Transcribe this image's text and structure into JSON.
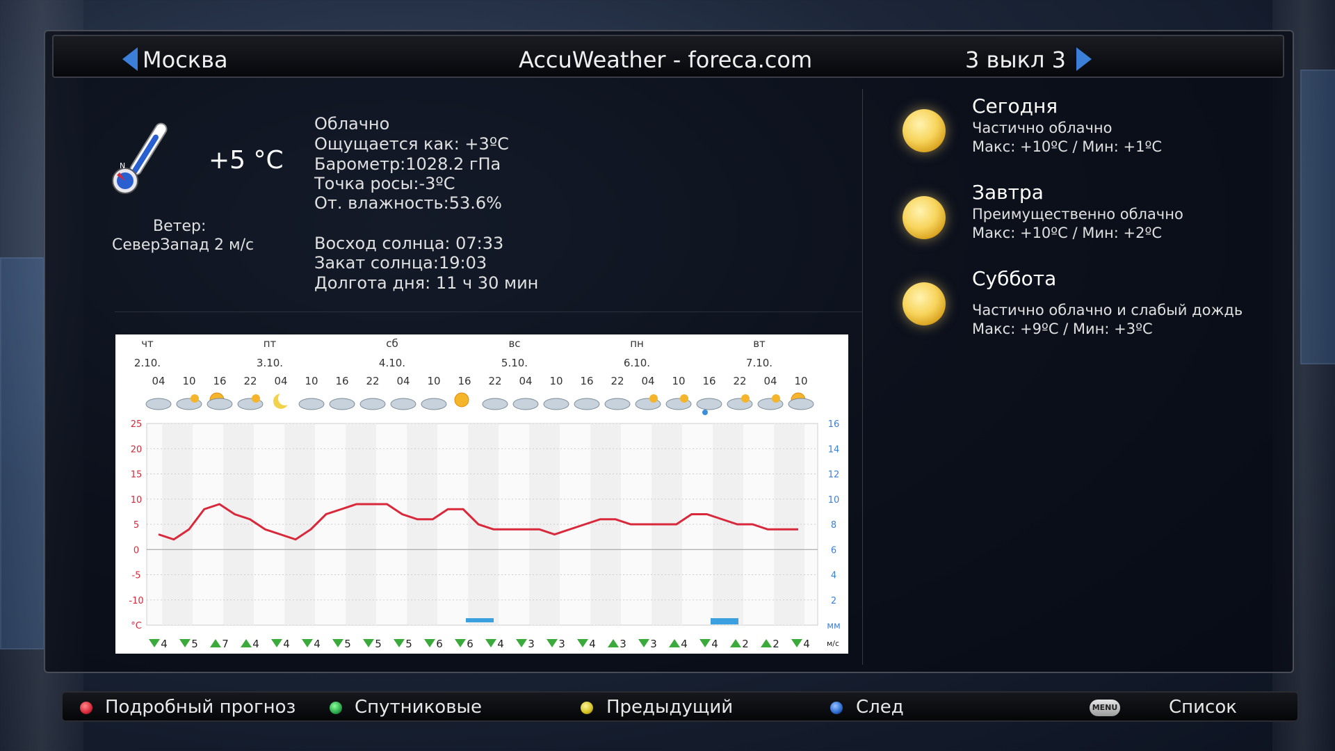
{
  "header": {
    "city": "Москва",
    "source": "AccuWeather - foreca.com",
    "page": "3 выкл 3"
  },
  "current": {
    "temperature": "+5 °C",
    "wind_label": "Ветер:",
    "wind_value": "СеверЗапад  2 м/с",
    "compass_letter": "N",
    "condition": "Облачно",
    "feels_like": "Ощущается как: +3ºC",
    "pressure": "Барометр:1028.2 гПа",
    "dew_point": "Точка росы:-3ºC",
    "humidity": "От. влажность:53.6%",
    "sunrise": "Восход солнца: 07:33",
    "sunset": "Закат солнца:19:03",
    "day_length": "Долгота дня: 11 ч 30 мин"
  },
  "forecast": [
    {
      "day": "Сегодня",
      "desc": "Частично облачно",
      "minmax": "Макс: +10ºC / Мин: +1ºC",
      "icon": "sun-icon"
    },
    {
      "day": "Завтра",
      "desc": "Преимущественно облачно",
      "minmax": "Макс: +10ºC / Мин: +2ºC",
      "icon": "sun-icon"
    },
    {
      "day": "Суббота",
      "desc": "Частично облачно и слабый дождь",
      "minmax": "Макс: +9ºC / Мин: +3ºC",
      "icon": "sun-icon"
    }
  ],
  "chart_data": {
    "type": "line",
    "days": [
      {
        "name": "чт",
        "date": "2.10."
      },
      {
        "name": "пт",
        "date": "3.10."
      },
      {
        "name": "сб",
        "date": "4.10."
      },
      {
        "name": "вс",
        "date": "5.10."
      },
      {
        "name": "пн",
        "date": "6.10."
      },
      {
        "name": "вт",
        "date": "7.10."
      }
    ],
    "hours": [
      "04",
      "10",
      "16",
      "22",
      "04",
      "10",
      "16",
      "22",
      "04",
      "10",
      "16",
      "22",
      "04",
      "10",
      "16",
      "22",
      "04",
      "10",
      "16",
      "22",
      "04",
      "10"
    ],
    "icons": [
      "cloud",
      "partly-cloudy",
      "sun-cloud",
      "partly-cloudy",
      "moon",
      "cloud",
      "cloud",
      "cloud",
      "cloud",
      "cloud",
      "sun",
      "cloud",
      "cloud",
      "cloud",
      "cloud",
      "cloud",
      "partly-cloudy",
      "partly-cloudy",
      "rain",
      "partly-cloudy",
      "partly-cloudy",
      "sun-cloud"
    ],
    "y_left_ticks": [
      "25",
      "20",
      "15",
      "10",
      "5",
      "0",
      "-5",
      "-10",
      "°C"
    ],
    "y_right_ticks": [
      "16",
      "14",
      "12",
      "10",
      "8",
      "6",
      "4",
      "2",
      "мм"
    ],
    "ylim": [
      -15,
      25
    ],
    "temperature": [
      3,
      2,
      4,
      8,
      9,
      7,
      6,
      4,
      3,
      2,
      4,
      7,
      8,
      9,
      9,
      9,
      7,
      6,
      6,
      8,
      8,
      5,
      4,
      4,
      4,
      4,
      3,
      4,
      5,
      6,
      6,
      5,
      5,
      5,
      5,
      7,
      7,
      6,
      5,
      5,
      4,
      4,
      4
    ],
    "precip_bars": [
      {
        "x_index": 10.5,
        "value": 0.4
      },
      {
        "x_index": 18.5,
        "value": 0.6
      }
    ],
    "wind": [
      "4",
      "5",
      "7",
      "4",
      "4",
      "4",
      "5",
      "5",
      "5",
      "6",
      "6",
      "4",
      "3",
      "3",
      "4",
      "3",
      "3",
      "4",
      "4",
      "2",
      "2",
      "4"
    ],
    "wind_dir": [
      "down",
      "down",
      "up",
      "up",
      "down",
      "down",
      "down",
      "down",
      "down",
      "down",
      "down",
      "down",
      "down",
      "down",
      "down",
      "up",
      "down",
      "up",
      "down",
      "up",
      "up",
      "down"
    ],
    "wind_unit": "м/с",
    "line_color": "#d8283a"
  },
  "bottom": {
    "red": "Подробный прогноз",
    "green": "Спутниковые",
    "yellow": "Предыдущий",
    "blue": "След",
    "menu_icon": "MENU",
    "list": "Список"
  },
  "colors": {
    "red": "#d8283a",
    "green": "#2aa84a",
    "yellow": "#d4c020",
    "blue": "#2a6ad0",
    "accent": "#3b7fd9"
  }
}
